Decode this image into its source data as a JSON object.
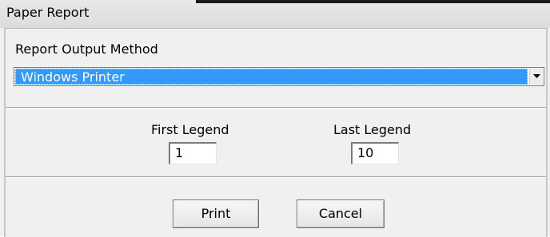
{
  "window": {
    "title": "Paper Report"
  },
  "output": {
    "label": "Report Output Method",
    "selected": "Windows Printer"
  },
  "legend": {
    "first_label": "First Legend",
    "first_value": "1",
    "last_label": "Last Legend",
    "last_value": "10"
  },
  "buttons": {
    "print": "Print",
    "cancel": "Cancel"
  },
  "colors": {
    "selection": "#3399ff",
    "background": "#f0f0f0"
  }
}
